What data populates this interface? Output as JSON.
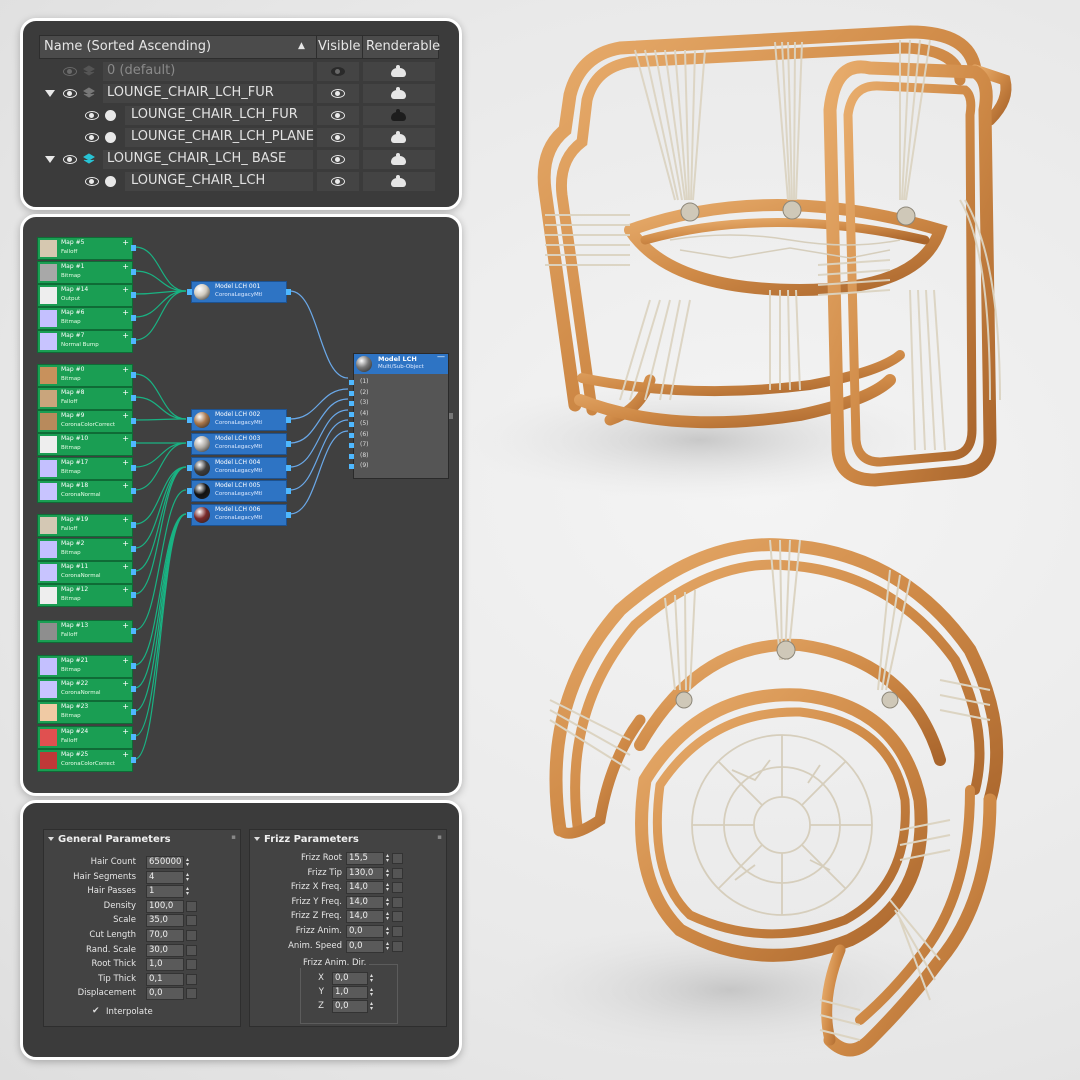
{
  "explorer": {
    "header": {
      "name": "Name (Sorted Ascending)",
      "sort_arrow": "▲",
      "visible": "Visible",
      "renderable": "Renderable"
    },
    "rows": [
      {
        "name": "0 (default)",
        "depth": 0,
        "icon": "layer-icon",
        "state": "dimmed"
      },
      {
        "name": "LOUNGE_CHAIR_LCH_FUR",
        "depth": 0,
        "icon": "layer-icon",
        "expanded": true
      },
      {
        "name": "LOUNGE_CHAIR_LCH_FUR",
        "depth": 1,
        "icon": "object-icon"
      },
      {
        "name": "LOUNGE_CHAIR_LCH_PLANE",
        "depth": 1,
        "icon": "object-icon"
      },
      {
        "name": "LOUNGE_CHAIR_LCH_ BASE",
        "depth": 0,
        "icon": "layer-active-icon",
        "expanded": true
      },
      {
        "name": "LOUNGE_CHAIR_LCH",
        "depth": 1,
        "icon": "object-icon"
      }
    ]
  },
  "slate": {
    "maps": [
      {
        "name": "Map #5",
        "type": "Falloff",
        "color": "#d6c8b0"
      },
      {
        "name": "Map #1",
        "type": "Bitmap",
        "color": "#a8a8a8"
      },
      {
        "name": "Map #14",
        "type": "Output",
        "color": "#eeeeee"
      },
      {
        "name": "Map #6",
        "type": "Bitmap",
        "color": "#c4c0ff"
      },
      {
        "name": "Map #7",
        "type": "Normal Bump",
        "color": "#c8c4ff"
      },
      {
        "name": "Map #0",
        "type": "Bitmap",
        "color": "#c8915c"
      },
      {
        "name": "Map #8",
        "type": "Falloff",
        "color": "#c9a57c"
      },
      {
        "name": "Map #9",
        "type": "CoronaColorCorrect",
        "color": "#b88a5c"
      },
      {
        "name": "Map #10",
        "type": "Bitmap",
        "color": "#eeeeee"
      },
      {
        "name": "Map #17",
        "type": "Bitmap",
        "color": "#c4c0ff"
      },
      {
        "name": "Map #18",
        "type": "CoronaNormal",
        "color": "#c8c4ff"
      },
      {
        "name": "Map #19",
        "type": "Falloff",
        "color": "#d4c8b4"
      },
      {
        "name": "Map #2",
        "type": "Bitmap",
        "color": "#c4c0ff"
      },
      {
        "name": "Map #11",
        "type": "CoronaNormal",
        "color": "#c8c4ff"
      },
      {
        "name": "Map #12",
        "type": "Bitmap",
        "color": "#eeeeee"
      },
      {
        "name": "Map #13",
        "type": "Falloff",
        "color": "#8e8e8e"
      },
      {
        "name": "Map #21",
        "type": "Bitmap",
        "color": "#c4c0ff"
      },
      {
        "name": "Map #22",
        "type": "CoronaNormal",
        "color": "#c8c4ff"
      },
      {
        "name": "Map #23",
        "type": "Bitmap",
        "color": "#f0caa4"
      },
      {
        "name": "Map #24",
        "type": "Falloff",
        "color": "#e05050"
      },
      {
        "name": "Map #25",
        "type": "CoronaColorCorrect",
        "color": "#c03838"
      }
    ],
    "materials": [
      {
        "name": "Model LCH 001",
        "type": "CoronaLegacyMtl",
        "ball": "#cfc9bd"
      },
      {
        "name": "Model LCH 002",
        "type": "CoronaLegacyMtl",
        "ball": "#a8764a"
      },
      {
        "name": "Model LCH 003",
        "type": "CoronaLegacyMtl",
        "ball": "#b0aca6"
      },
      {
        "name": "Model LCH 004",
        "type": "CoronaLegacyMtl",
        "ball": "#3d3d3d"
      },
      {
        "name": "Model LCH 005",
        "type": "CoronaLegacyMtl",
        "ball": "#111111"
      },
      {
        "name": "Model LCH 006",
        "type": "CoronaLegacyMtl",
        "ball": "#7a2a2a"
      }
    ],
    "multi": {
      "name": "Model LCH",
      "type": "Multi/Sub-Object",
      "collapse": "—",
      "slots": [
        "(1)",
        "(2)",
        "(3)",
        "(4)",
        "(5)",
        "(6)",
        "(7)",
        "(8)",
        "(9)"
      ]
    }
  },
  "params": {
    "general": {
      "title": "General Parameters",
      "rows": [
        {
          "label": "Hair Count",
          "value": "650000"
        },
        {
          "label": "Hair Segments",
          "value": "4"
        },
        {
          "label": "Hair Passes",
          "value": "1"
        },
        {
          "label": "Density",
          "value": "100,0"
        },
        {
          "label": "Scale",
          "value": "35,0"
        },
        {
          "label": "Cut Length",
          "value": "70,0"
        },
        {
          "label": "Rand. Scale",
          "value": "30,0"
        },
        {
          "label": "Root Thick",
          "value": "1,0"
        },
        {
          "label": "Tip Thick",
          "value": "0,1"
        },
        {
          "label": "Displacement",
          "value": "0,0"
        }
      ],
      "interpolate": "Interpolate"
    },
    "frizz": {
      "title": "Frizz Parameters",
      "rows": [
        {
          "label": "Frizz Root",
          "value": "15,5"
        },
        {
          "label": "Frizz Tip",
          "value": "130,0"
        },
        {
          "label": "Frizz X Freq.",
          "value": "14,0"
        },
        {
          "label": "Frizz Y Freq.",
          "value": "14,0"
        },
        {
          "label": "Frizz Z Freq.",
          "value": "14,0"
        },
        {
          "label": "Frizz Anim.",
          "value": "0,0"
        },
        {
          "label": "Anim. Speed",
          "value": "0,0"
        }
      ],
      "dir_title": "Frizz Anim. Dir.",
      "dir": [
        {
          "label": "X",
          "value": "0,0"
        },
        {
          "label": "Y",
          "value": "1,0"
        },
        {
          "label": "Z",
          "value": "0,0"
        }
      ]
    }
  },
  "colors": {
    "panel": "#3b3b3b",
    "node_green": "#1a9e53",
    "node_blue": "#2e74c4",
    "wire": "#19b383",
    "rattan": "#d3914f",
    "rope": "#ddd6c6"
  }
}
